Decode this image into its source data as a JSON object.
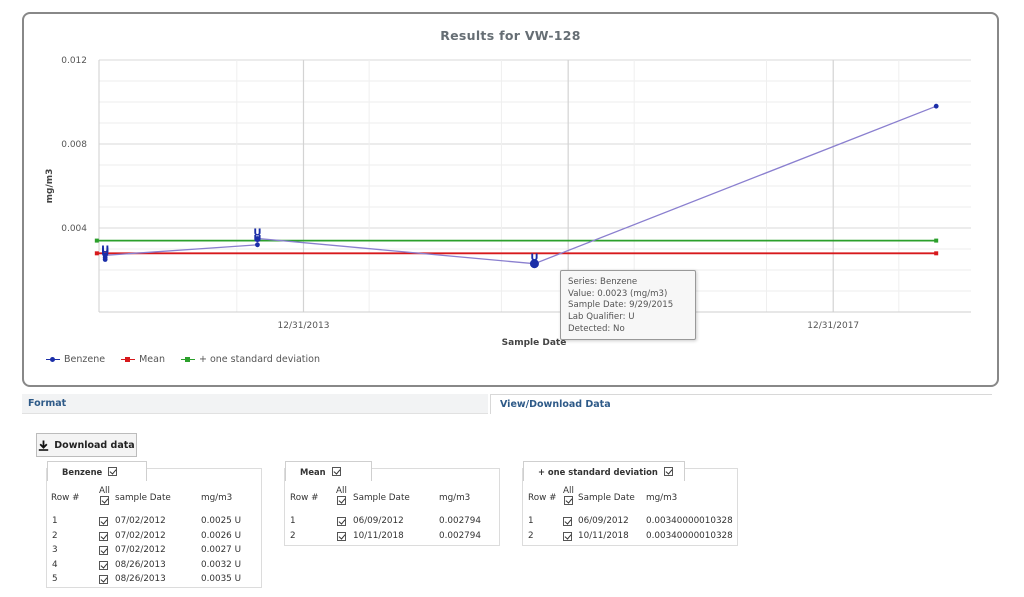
{
  "chart_data": {
    "type": "line",
    "title": "Results for VW-128",
    "ylabel": "mg/m3",
    "xlabel": "Sample Date",
    "ylim": [
      0,
      0.012
    ],
    "yticks": [
      "0.012",
      "0.008",
      "0.004"
    ],
    "xticks": [
      "12/31/2013",
      "12/31/2017"
    ],
    "x_range": [
      "2012-06-15",
      "2019-01-15"
    ],
    "series": [
      {
        "name": "Benzene",
        "color": "#8a7fcf",
        "marker_color": "#1b2ea8",
        "x": [
          "2012-07-02",
          "2012-07-02",
          "2012-07-02",
          "2013-08-26",
          "2013-08-26",
          "2015-09-29",
          "2018-10-11"
        ],
        "values": [
          0.0025,
          0.0026,
          0.0027,
          0.0032,
          0.0035,
          0.0023,
          0.0098
        ],
        "qualifier": [
          "U",
          "U",
          "U",
          "U",
          "U",
          "U",
          ""
        ]
      },
      {
        "name": "Mean",
        "color": "#d7191c",
        "x": [
          "2012-06-09",
          "2018-10-11"
        ],
        "values": [
          0.002794,
          0.002794
        ]
      },
      {
        "name": "+ one standard deviation",
        "color": "#2ca02c",
        "x": [
          "2012-06-09",
          "2018-10-11"
        ],
        "values": [
          0.00340000010328,
          0.00340000010328
        ]
      }
    ]
  },
  "tooltip": {
    "series": "Series: Benzene",
    "value": "Value: 0.0023 (mg/m3)",
    "date": "Sample Date: 9/29/2015",
    "qualifier": "Lab Qualifier: U",
    "detected": "Detected: No"
  },
  "tabs": {
    "format": "Format",
    "view": "View/Download Data"
  },
  "download_label": "Download data",
  "tables": {
    "benzene": {
      "title": "Benzene",
      "headers": {
        "row": "Row #",
        "all": "All",
        "date": "sample Date",
        "value": "mg/m3"
      },
      "rows": [
        {
          "n": "1",
          "date": "07/02/2012",
          "value": "0.0025 U"
        },
        {
          "n": "2",
          "date": "07/02/2012",
          "value": "0.0026 U"
        },
        {
          "n": "3",
          "date": "07/02/2012",
          "value": "0.0027 U"
        },
        {
          "n": "4",
          "date": "08/26/2013",
          "value": "0.0032 U"
        },
        {
          "n": "5",
          "date": "08/26/2013",
          "value": "0.0035 U"
        }
      ]
    },
    "mean": {
      "title": "Mean",
      "headers": {
        "row": "Row #",
        "all": "All",
        "date": "Sample Date",
        "value": "mg/m3"
      },
      "rows": [
        {
          "n": "1",
          "date": "06/09/2012",
          "value": "0.002794"
        },
        {
          "n": "2",
          "date": "10/11/2018",
          "value": "0.002794"
        }
      ]
    },
    "stddev": {
      "title": "+ one standard deviation",
      "headers": {
        "row": "Row #",
        "all": "All",
        "date": "Sample Date",
        "value": "mg/m3"
      },
      "rows": [
        {
          "n": "1",
          "date": "06/09/2012",
          "value": "0.00340000010328"
        },
        {
          "n": "2",
          "date": "10/11/2018",
          "value": "0.00340000010328"
        }
      ]
    }
  }
}
